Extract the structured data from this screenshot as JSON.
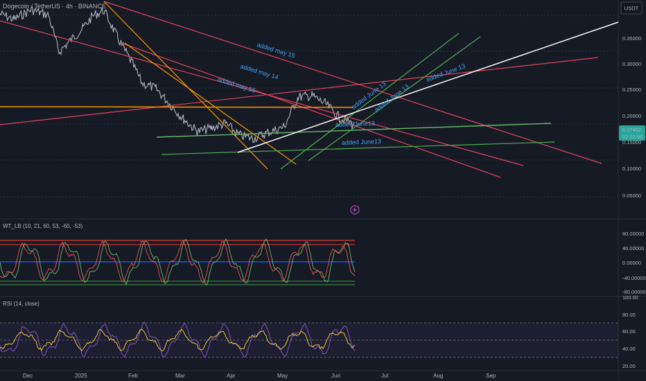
{
  "header": {
    "symbol_title": "Dogecoin / TetherUS · 4h · BINANCE",
    "currency_button": "USDT"
  },
  "price_axis": {
    "labels": [
      "0.35000",
      "0.30000",
      "0.25000",
      "0.20000",
      "0.15000",
      "0.10000",
      "0.05000"
    ],
    "current_price": "0.17462",
    "countdown": "02:02:55",
    "hidden_label": "0.15000",
    "accent_color": "#26a69a"
  },
  "time_axis": {
    "labels": [
      "Dec",
      "2025",
      "Feb",
      "Mar",
      "Apr",
      "May",
      "Jun",
      "Jul",
      "Aug",
      "Sep"
    ]
  },
  "annotations": [
    {
      "text": "added may 15"
    },
    {
      "text": "added may 14"
    },
    {
      "text": "added may 15"
    },
    {
      "text": "added June 13"
    },
    {
      "text": "added June 13"
    },
    {
      "text": "added June 13"
    },
    {
      "text": "added June13"
    },
    {
      "text": "added June13"
    }
  ],
  "wt_pane": {
    "title": "WT_LB (10, 21, 60, 53, -60, -53)",
    "labels": [
      "80.00000",
      "40.00000",
      "0.00000",
      "-40.00000",
      "-80.00000"
    ]
  },
  "rsi_pane": {
    "title": "RSI (14, close)",
    "labels": [
      "100.00",
      "80.00",
      "60.00",
      "40.00",
      "20.00"
    ]
  },
  "icons": {
    "alert": "lightning-icon"
  }
}
